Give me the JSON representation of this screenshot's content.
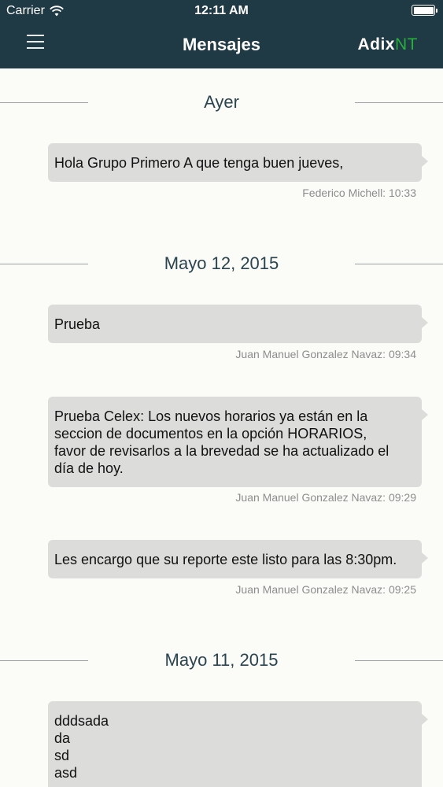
{
  "status_bar": {
    "carrier": "Carrier",
    "time": "12:11 AM",
    "wifi_icon": "wifi-icon",
    "battery_icon": "battery-icon"
  },
  "navbar": {
    "menu_icon": "hamburger-menu-icon",
    "title": "Mensajes",
    "brand_part1": "Adix",
    "brand_part2": "NT",
    "background_color": "#1f3a45",
    "brand_accent_color": "#27ae3c"
  },
  "groups": [
    {
      "date": "Ayer",
      "messages": [
        {
          "text": "Hola Grupo Primero A que tenga buen jueves,",
          "meta": "Federico Michell: 10:33"
        }
      ]
    },
    {
      "date": "Mayo 12, 2015",
      "messages": [
        {
          "text": "Prueba",
          "meta": "Juan Manuel Gonzalez Navaz: 09:34"
        },
        {
          "text": "Prueba Celex: Los nuevos horarios ya están en la\nseccion de documentos en la opción HORARIOS,\nfavor de revisarlos a la brevedad se ha actualizado el\ndía de hoy.",
          "meta": "Juan Manuel Gonzalez Navaz: 09:29"
        },
        {
          "text": "Les encargo que su reporte este listo para las 8:30pm.",
          "meta": "Juan Manuel Gonzalez Navaz: 09:25"
        }
      ]
    },
    {
      "date": "Mayo 11, 2015",
      "messages": [
        {
          "text": "dddsada\nda\nsd\nasd",
          "meta": ""
        }
      ]
    }
  ]
}
